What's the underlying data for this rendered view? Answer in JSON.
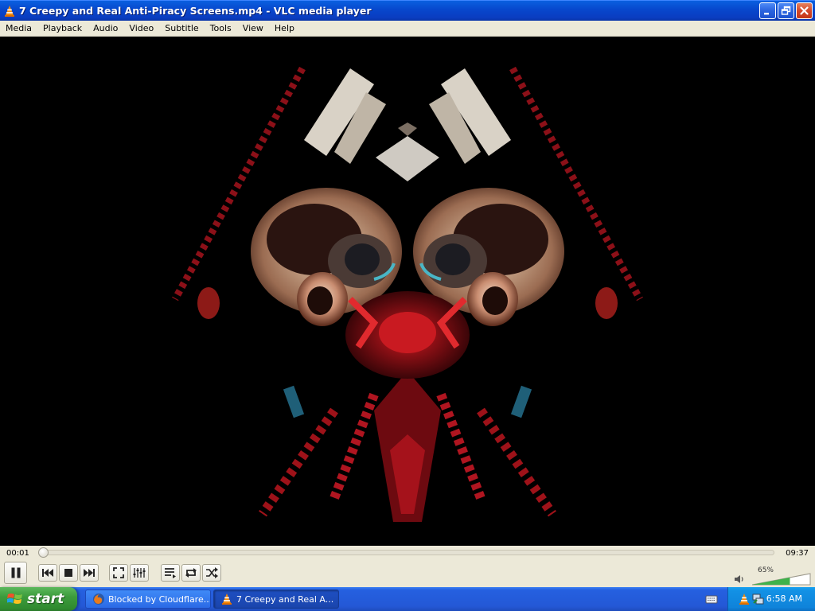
{
  "window": {
    "title": "7 Creepy and Real Anti-Piracy Screens.mp4 - VLC media player",
    "buttons": [
      "minimize",
      "maximize",
      "close"
    ]
  },
  "menu": {
    "items": [
      "Media",
      "Playback",
      "Audio",
      "Video",
      "Subtitle",
      "Tools",
      "View",
      "Help"
    ]
  },
  "player": {
    "elapsed": "00:01",
    "total": "09:37",
    "progress_fraction": 0.002,
    "volume_label": "65%",
    "volume_fraction": 0.65,
    "state": "playing"
  },
  "controls": {
    "icons": [
      "pause-icon",
      "previous-icon",
      "stop-icon",
      "next-icon",
      "fullscreen-icon",
      "extended-settings-icon",
      "playlist-icon",
      "loop-icon",
      "shuffle-icon",
      "volume-icon"
    ]
  },
  "taskbar": {
    "start_label": "start",
    "tasks": [
      {
        "label": "Blocked by Cloudflare...",
        "icon": "firefox-icon",
        "active": false
      },
      {
        "label": "7 Creepy and Real A...",
        "icon": "vlc-cone-icon",
        "active": true
      }
    ],
    "clock": "6:58 AM",
    "tray_icons": [
      "keyboard-icon",
      "vlc-cone-icon",
      "network-icon"
    ]
  },
  "colors": {
    "titlebar": "#0747cc",
    "menubar": "#ece9d8",
    "taskbar": "#2458d6",
    "start_green": "#3c9c3c",
    "video_bg": "#000000",
    "accent_red": "#b1121c"
  }
}
